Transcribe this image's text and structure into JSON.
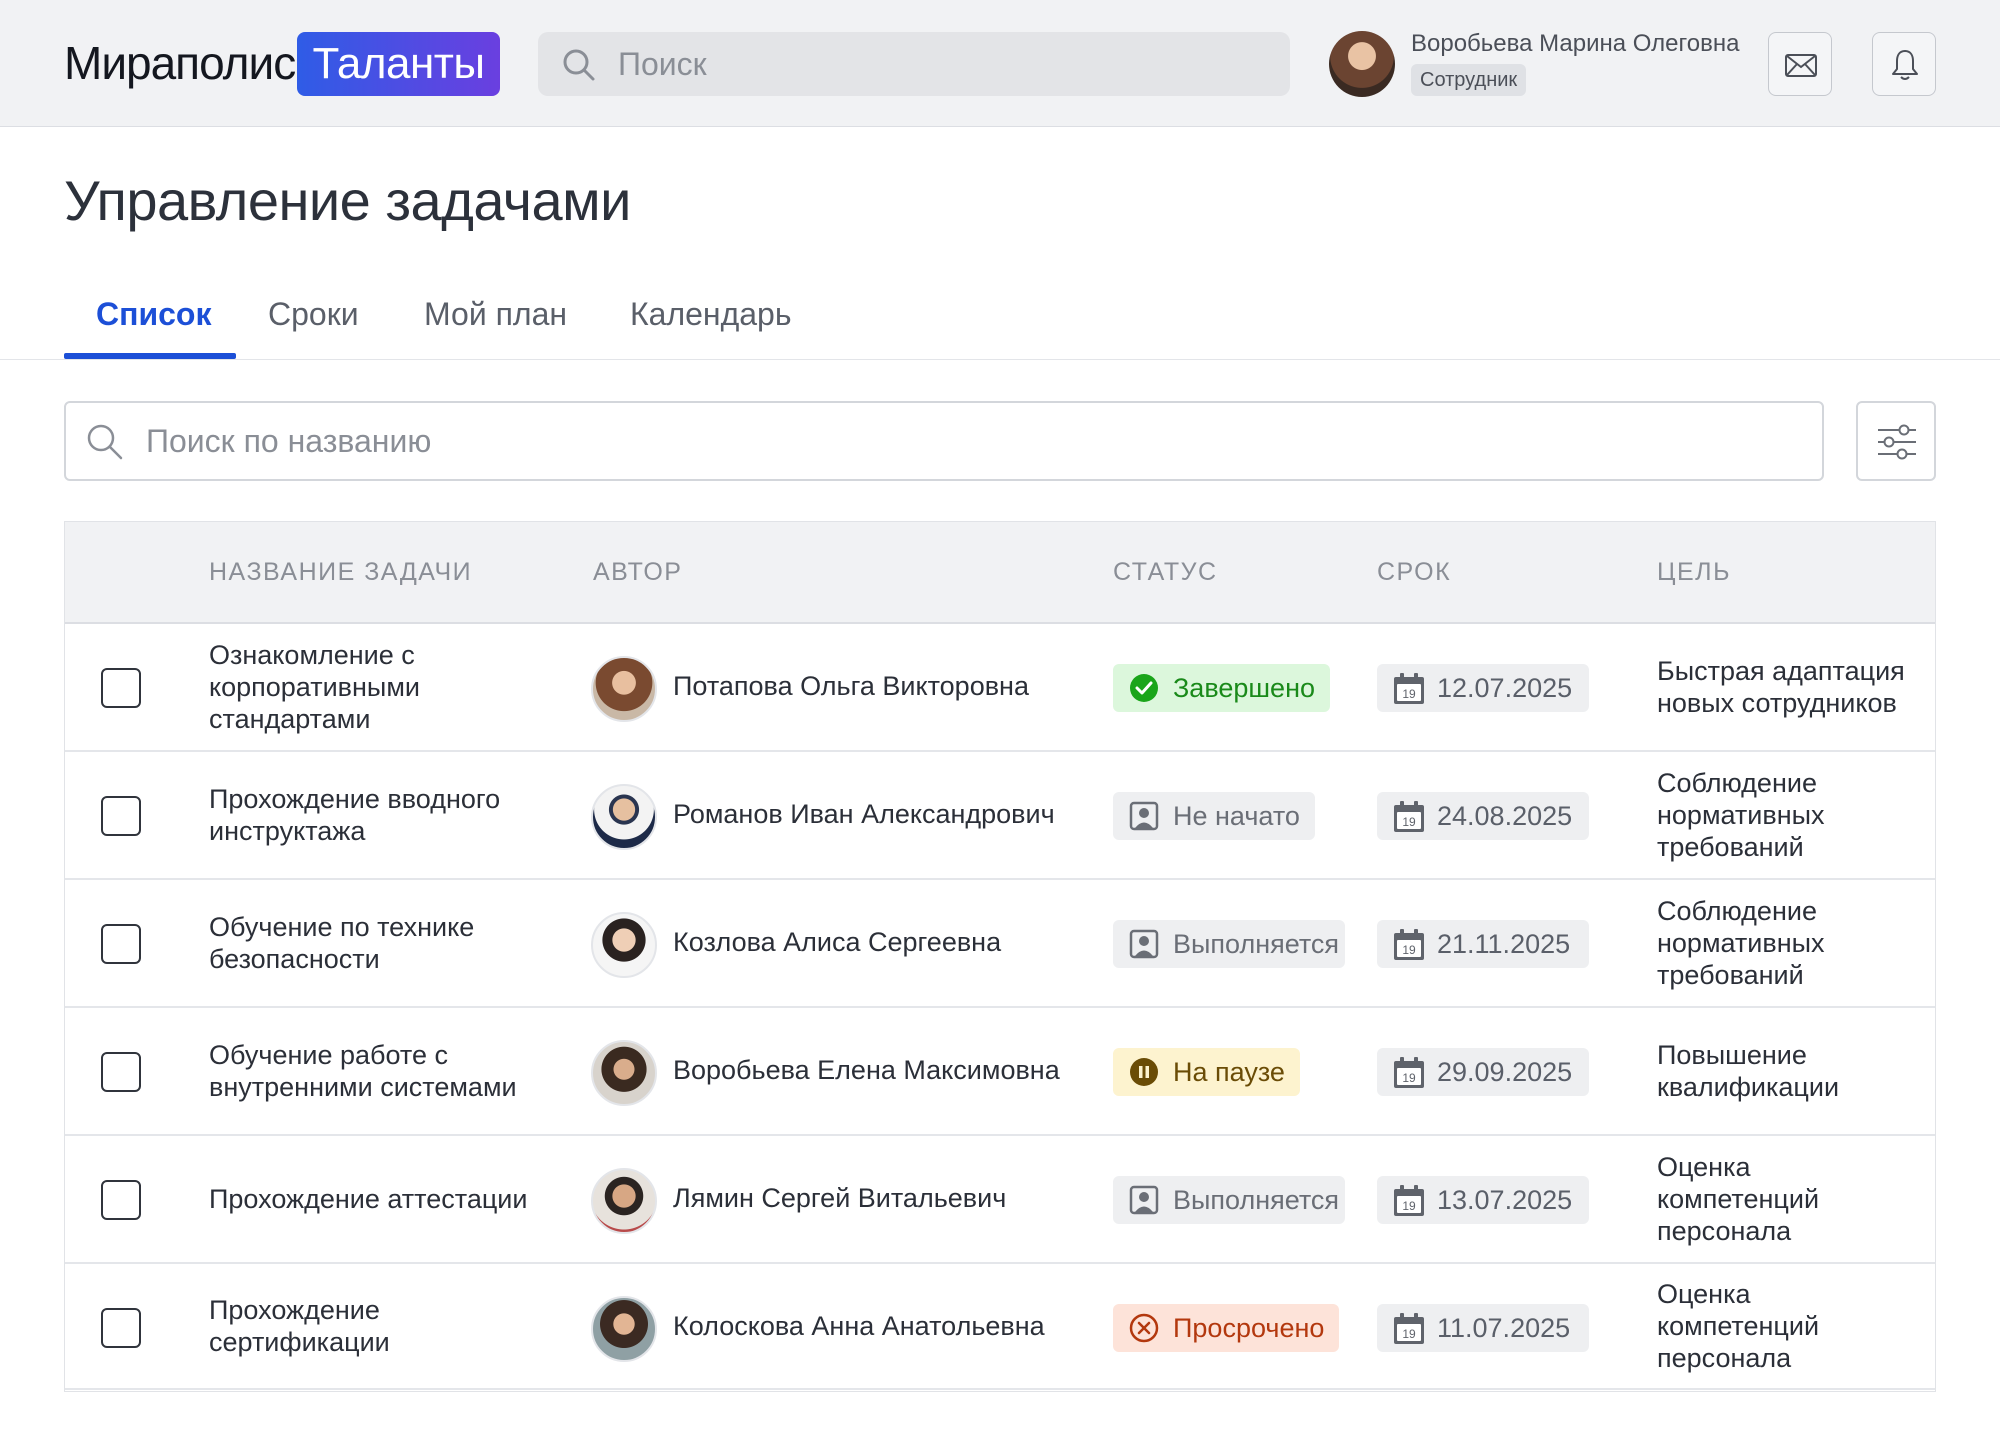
{
  "header": {
    "logo_text": "Мираполис",
    "logo_badge": "Таланты",
    "search_placeholder": "Поиск",
    "user_name": "Воробьева Марина Олеговна",
    "user_role": "Сотрудник"
  },
  "page": {
    "title": "Управление задачами"
  },
  "tabs": [
    {
      "label": "Список",
      "active": true
    },
    {
      "label": "Сроки",
      "active": false
    },
    {
      "label": "Мой план",
      "active": false
    },
    {
      "label": "Календарь",
      "active": false
    }
  ],
  "table_search": {
    "placeholder": "Поиск по названию"
  },
  "table": {
    "columns": [
      "НАЗВАНИЕ ЗАДАЧИ",
      "АВТОР",
      "СТАТУС",
      "СРОК",
      "ЦЕЛЬ"
    ],
    "rows": [
      {
        "task": "Ознакомление с корпоративными стандартами",
        "author": "Потапова Ольга Викторовна",
        "status": "Завершено",
        "status_type": "done",
        "date": "12.07.2025",
        "goal": "Быстрая адаптация новых сотрудников"
      },
      {
        "task": "Прохождение вводного инструктажа",
        "author": "Романов Иван Александрович",
        "status": "Не начато",
        "status_type": "gray",
        "date": "24.08.2025",
        "goal": "Соблюдение нормативных требований"
      },
      {
        "task": "Обучение по технике безопасности",
        "author": "Козлова Алиса Сергеевна",
        "status": "Выполняется",
        "status_type": "gray",
        "date": "21.11.2025",
        "goal": "Соблюдение нормативных требований"
      },
      {
        "task": "Обучение работе с внутренними системами",
        "author": "Воробьева Елена Максимовна",
        "status": "На паузе",
        "status_type": "pause",
        "date": "29.09.2025",
        "goal": "Повышение квалификации"
      },
      {
        "task": "Прохождение аттестации",
        "author": "Лямин Сергей Витальевич",
        "status": "Выполняется",
        "status_type": "gray",
        "date": "13.07.2025",
        "goal": "Оценка компетенций персонала"
      },
      {
        "task": "Прохождение сертификации",
        "author": "Колоскова Анна Анатольевна",
        "status": "Просрочено",
        "status_type": "overdue",
        "date": "11.07.2025",
        "goal": "Оценка компетенций персонала"
      }
    ]
  },
  "calendar_icon_day": "19",
  "colors": {
    "accent": "#1c4fd7",
    "status_done": "#1a8a1a",
    "status_pause": "#6a4c06",
    "status_overdue": "#b3380e"
  }
}
